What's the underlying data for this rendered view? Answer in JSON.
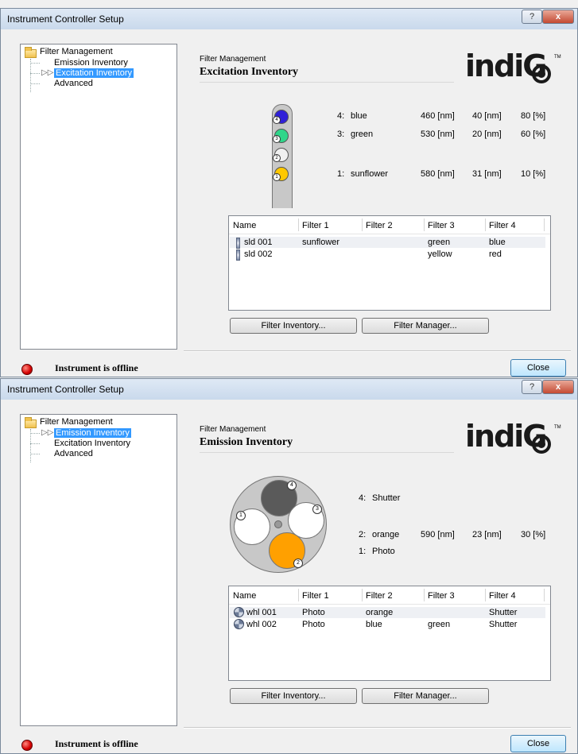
{
  "windows": [
    {
      "title": "Instrument Controller Setup",
      "help_label": "?",
      "close_x": "x",
      "tree": {
        "root": "Filter Management",
        "items": [
          "Emission Inventory",
          "Excitation Inventory",
          "Advanced"
        ],
        "selected": "Excitation Inventory"
      },
      "header_small": "Filter Management",
      "header_big": "Excitation Inventory",
      "logo_text": "indiG",
      "logo_tm": "TM",
      "filters": [
        {
          "pos": "4:",
          "name": "blue",
          "wl": "460 [nm]",
          "bw": "40 [nm]",
          "pct": "80 [%]"
        },
        {
          "pos": "3:",
          "name": "green",
          "wl": "530 [nm]",
          "bw": "20 [nm]",
          "pct": "60 [%]"
        },
        {
          "pos": "1:",
          "name": "sunflower",
          "wl": "580 [nm]",
          "bw": "31 [nm]",
          "pct": "10 [%]"
        }
      ],
      "slot_numbers": [
        "4",
        "3",
        "2",
        "1"
      ],
      "slot_colors": [
        "#2f1fd8",
        "#2fd68a",
        "#f0f0f0",
        "#ffc800"
      ],
      "columns": [
        "Name",
        "Filter 1",
        "Filter 2",
        "Filter 3",
        "Filter 4"
      ],
      "rows": [
        [
          "sld 001",
          "sunflower",
          "",
          "green",
          "blue"
        ],
        [
          "sld 002",
          "",
          "",
          "yellow",
          "red"
        ]
      ],
      "btn_inventory": "Filter Inventory...",
      "btn_manager": "Filter Manager...",
      "status": "Instrument is offline",
      "close_label": "Close"
    },
    {
      "title": "Instrument Controller Setup",
      "help_label": "?",
      "close_x": "x",
      "tree": {
        "root": "Filter Management",
        "items": [
          "Emission Inventory",
          "Excitation Inventory",
          "Advanced"
        ],
        "selected": "Emission Inventory"
      },
      "header_small": "Filter Management",
      "header_big": "Emission Inventory",
      "logo_text": "indiG",
      "logo_tm": "TM",
      "filters": [
        {
          "pos": "4:",
          "name": "Shutter",
          "wl": "",
          "bw": "",
          "pct": ""
        },
        {
          "pos": "2:",
          "name": "orange",
          "wl": "590 [nm]",
          "bw": "23 [nm]",
          "pct": "30 [%]"
        },
        {
          "pos": "1:",
          "name": "Photo",
          "wl": "",
          "bw": "",
          "pct": ""
        }
      ],
      "slot_numbers": [
        "4",
        "3",
        "2",
        "1"
      ],
      "slot_colors": [
        "#5a5a5a",
        "#ffffff",
        "#ffa000",
        "#ffffff"
      ],
      "columns": [
        "Name",
        "Filter 1",
        "Filter 2",
        "Filter 3",
        "Filter 4"
      ],
      "rows": [
        [
          "whl 001",
          "Photo",
          "orange",
          "",
          "Shutter"
        ],
        [
          "whl 002",
          "Photo",
          "blue",
          "green",
          "Shutter"
        ]
      ],
      "btn_inventory": "Filter Inventory...",
      "btn_manager": "Filter Manager...",
      "status": "Instrument is offline",
      "close_label": "Close"
    }
  ]
}
